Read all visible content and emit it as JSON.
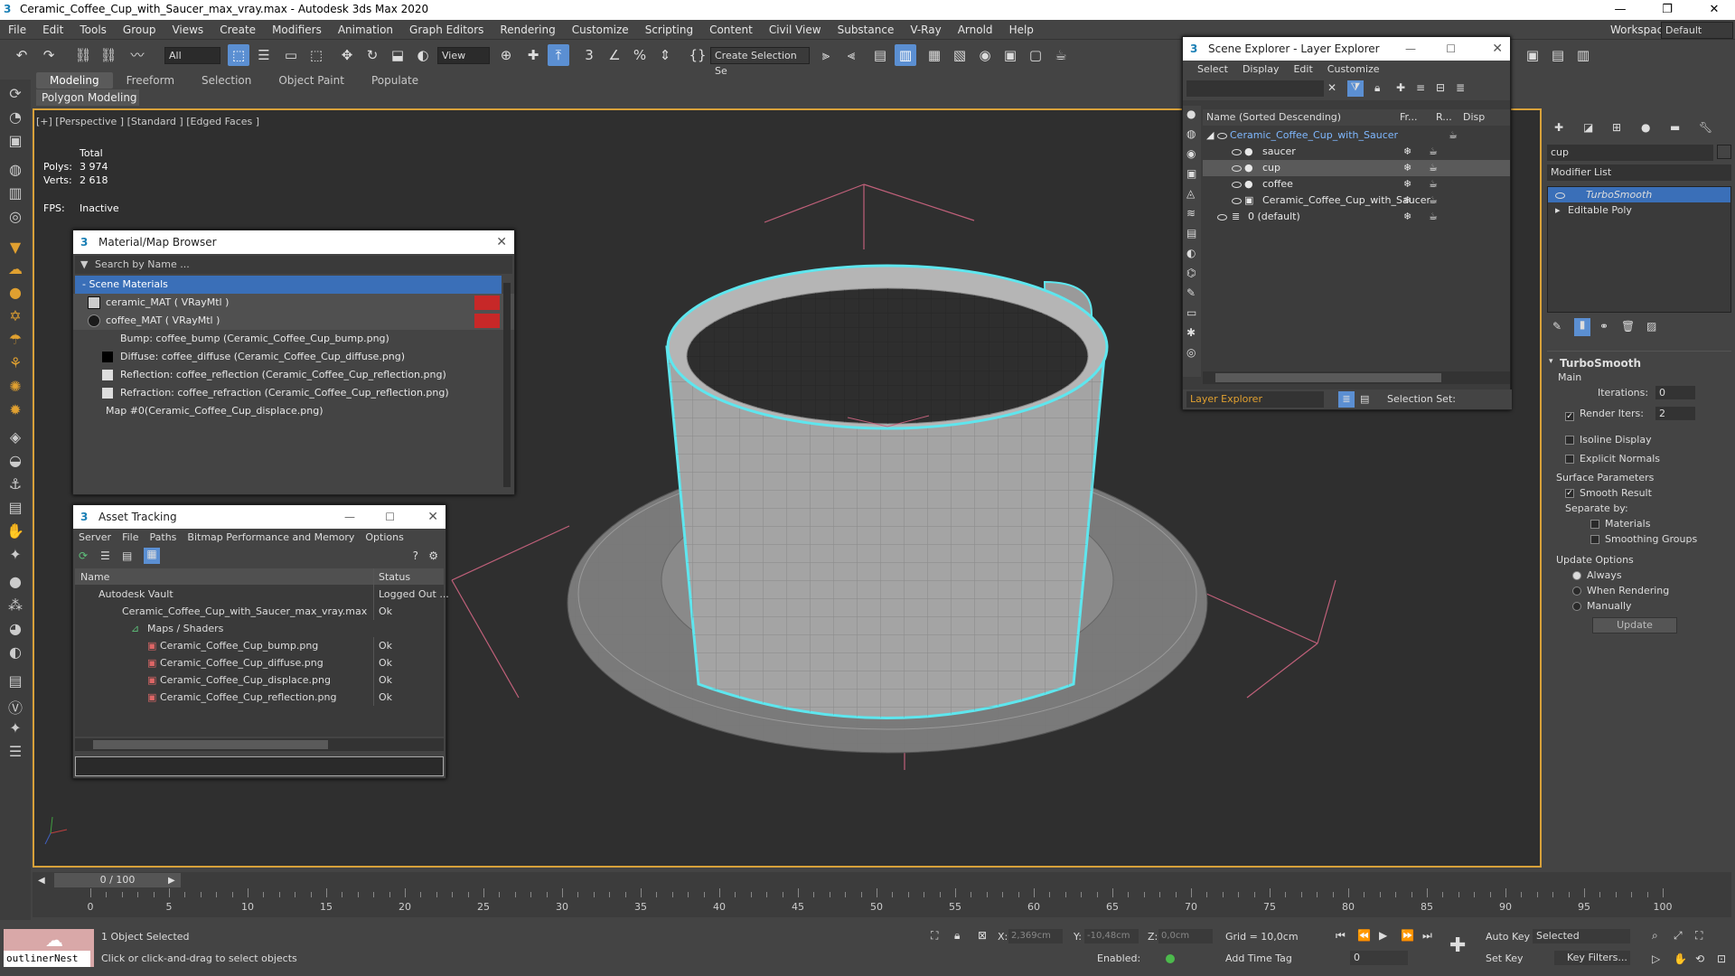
{
  "window": {
    "title": "Ceramic_Coffee_Cup_with_Saucer_max_vray.max - Autodesk 3ds Max 2020",
    "min": "—",
    "max": "❐",
    "close": "✕"
  },
  "menu": [
    "File",
    "Edit",
    "Tools",
    "Group",
    "Views",
    "Create",
    "Modifiers",
    "Animation",
    "Graph Editors",
    "Rendering",
    "Customize",
    "Scripting",
    "Content",
    "Civil View",
    "Substance",
    "V-Ray",
    "Arnold",
    "Help"
  ],
  "workspaces": {
    "label": "Workspaces:",
    "value": "Default"
  },
  "toolbar": {
    "filter": "All",
    "refcoord": "View",
    "selset": "Create Selection Se"
  },
  "ribbon": {
    "tabs": [
      "Modeling",
      "Freeform",
      "Selection",
      "Object Paint",
      "Populate"
    ],
    "sub": "Polygon Modeling"
  },
  "viewport": {
    "label": "[+] [Perspective ] [Standard ] [Edged Faces ]",
    "total": "Total",
    "polys_label": "Polys:",
    "polys": "3 974",
    "verts_label": "Verts:",
    "verts": "2 618",
    "fps_label": "FPS:",
    "fps": "Inactive"
  },
  "mmb": {
    "title": "Material/Map Browser",
    "search": "Search by Name ...",
    "group": "- Scene Materials",
    "rows": [
      "ceramic_MAT  ( VRayMtl )",
      "coffee_MAT  ( VRayMtl )",
      "Bump: coffee_bump (Ceramic_Coffee_Cup_bump.png)",
      "Diffuse: coffee_diffuse (Ceramic_Coffee_Cup_diffuse.png)",
      "Reflection: coffee_reflection (Ceramic_Coffee_Cup_reflection.png)",
      "Refraction: coffee_refraction (Ceramic_Coffee_Cup_reflection.png)",
      "Map #0(Ceramic_Coffee_Cup_displace.png)"
    ]
  },
  "asset": {
    "title": "Asset Tracking",
    "menu": [
      "Server",
      "File",
      "Paths",
      "Bitmap Performance and Memory",
      "Options"
    ],
    "col_name": "Name",
    "col_status": "Status",
    "rows": [
      {
        "name": "Autodesk Vault",
        "status": "Logged Out ..."
      },
      {
        "name": "Ceramic_Coffee_Cup_with_Saucer_max_vray.max",
        "status": "Ok"
      },
      {
        "name": "Maps / Shaders",
        "status": ""
      },
      {
        "name": "Ceramic_Coffee_Cup_bump.png",
        "status": "Ok"
      },
      {
        "name": "Ceramic_Coffee_Cup_diffuse.png",
        "status": "Ok"
      },
      {
        "name": "Ceramic_Coffee_Cup_displace.png",
        "status": "Ok"
      },
      {
        "name": "Ceramic_Coffee_Cup_reflection.png",
        "status": "Ok"
      }
    ]
  },
  "scene": {
    "title": "Scene Explorer - Layer Explorer",
    "menu": [
      "Select",
      "Display",
      "Edit",
      "Customize"
    ],
    "col_name": "Name (Sorted Descending)",
    "col_fr": "Fr...",
    "col_r": "R...",
    "col_disp": "Disp",
    "rows": [
      "Ceramic_Coffee_Cup_with_Saucer",
      "saucer",
      "cup",
      "coffee",
      "Ceramic_Coffee_Cup_with_Saucer",
      "0 (default)"
    ],
    "footer": "Layer Explorer",
    "selset": "Selection Set:"
  },
  "cmd": {
    "search": "cup",
    "modlist": "Modifier List",
    "stack": [
      "TurboSmooth",
      "Editable Poly"
    ],
    "rollout": "TurboSmooth",
    "main": "Main",
    "iter_label": "Iterations:",
    "iter": "0",
    "render_label": "Render Iters:",
    "render": "2",
    "isoline": "Isoline Display",
    "explicit": "Explicit Normals",
    "surf": "Surface Parameters",
    "smooth": "Smooth Result",
    "sepby": "Separate by:",
    "materials": "Materials",
    "smgroups": "Smoothing Groups",
    "update_opts": "Update Options",
    "always": "Always",
    "whenrender": "When Rendering",
    "manually": "Manually",
    "update": "Update"
  },
  "timeline": {
    "frame": "0 / 100",
    "ticks": [
      "0",
      "5",
      "10",
      "15",
      "20",
      "25",
      "30",
      "35",
      "40",
      "45",
      "50",
      "55",
      "60",
      "65",
      "70",
      "75",
      "80",
      "85",
      "90",
      "95",
      "100"
    ]
  },
  "status": {
    "selected": "1 Object Selected",
    "prompt": "Click or click-and-drag to select objects",
    "x_label": "X:",
    "x": "2,369cm",
    "y_label": "Y:",
    "y": "-10,48cm",
    "z_label": "Z:",
    "z": "0,0cm",
    "grid": "Grid = 10,0cm",
    "enabled": "Enabled:",
    "addtime": "Add Time Tag",
    "autokey": "Auto Key",
    "setkey": "Set Key",
    "keyfilters": "Key Filters...",
    "selmode": "Selected",
    "frame": "0",
    "outliner": "outlinerNest"
  }
}
